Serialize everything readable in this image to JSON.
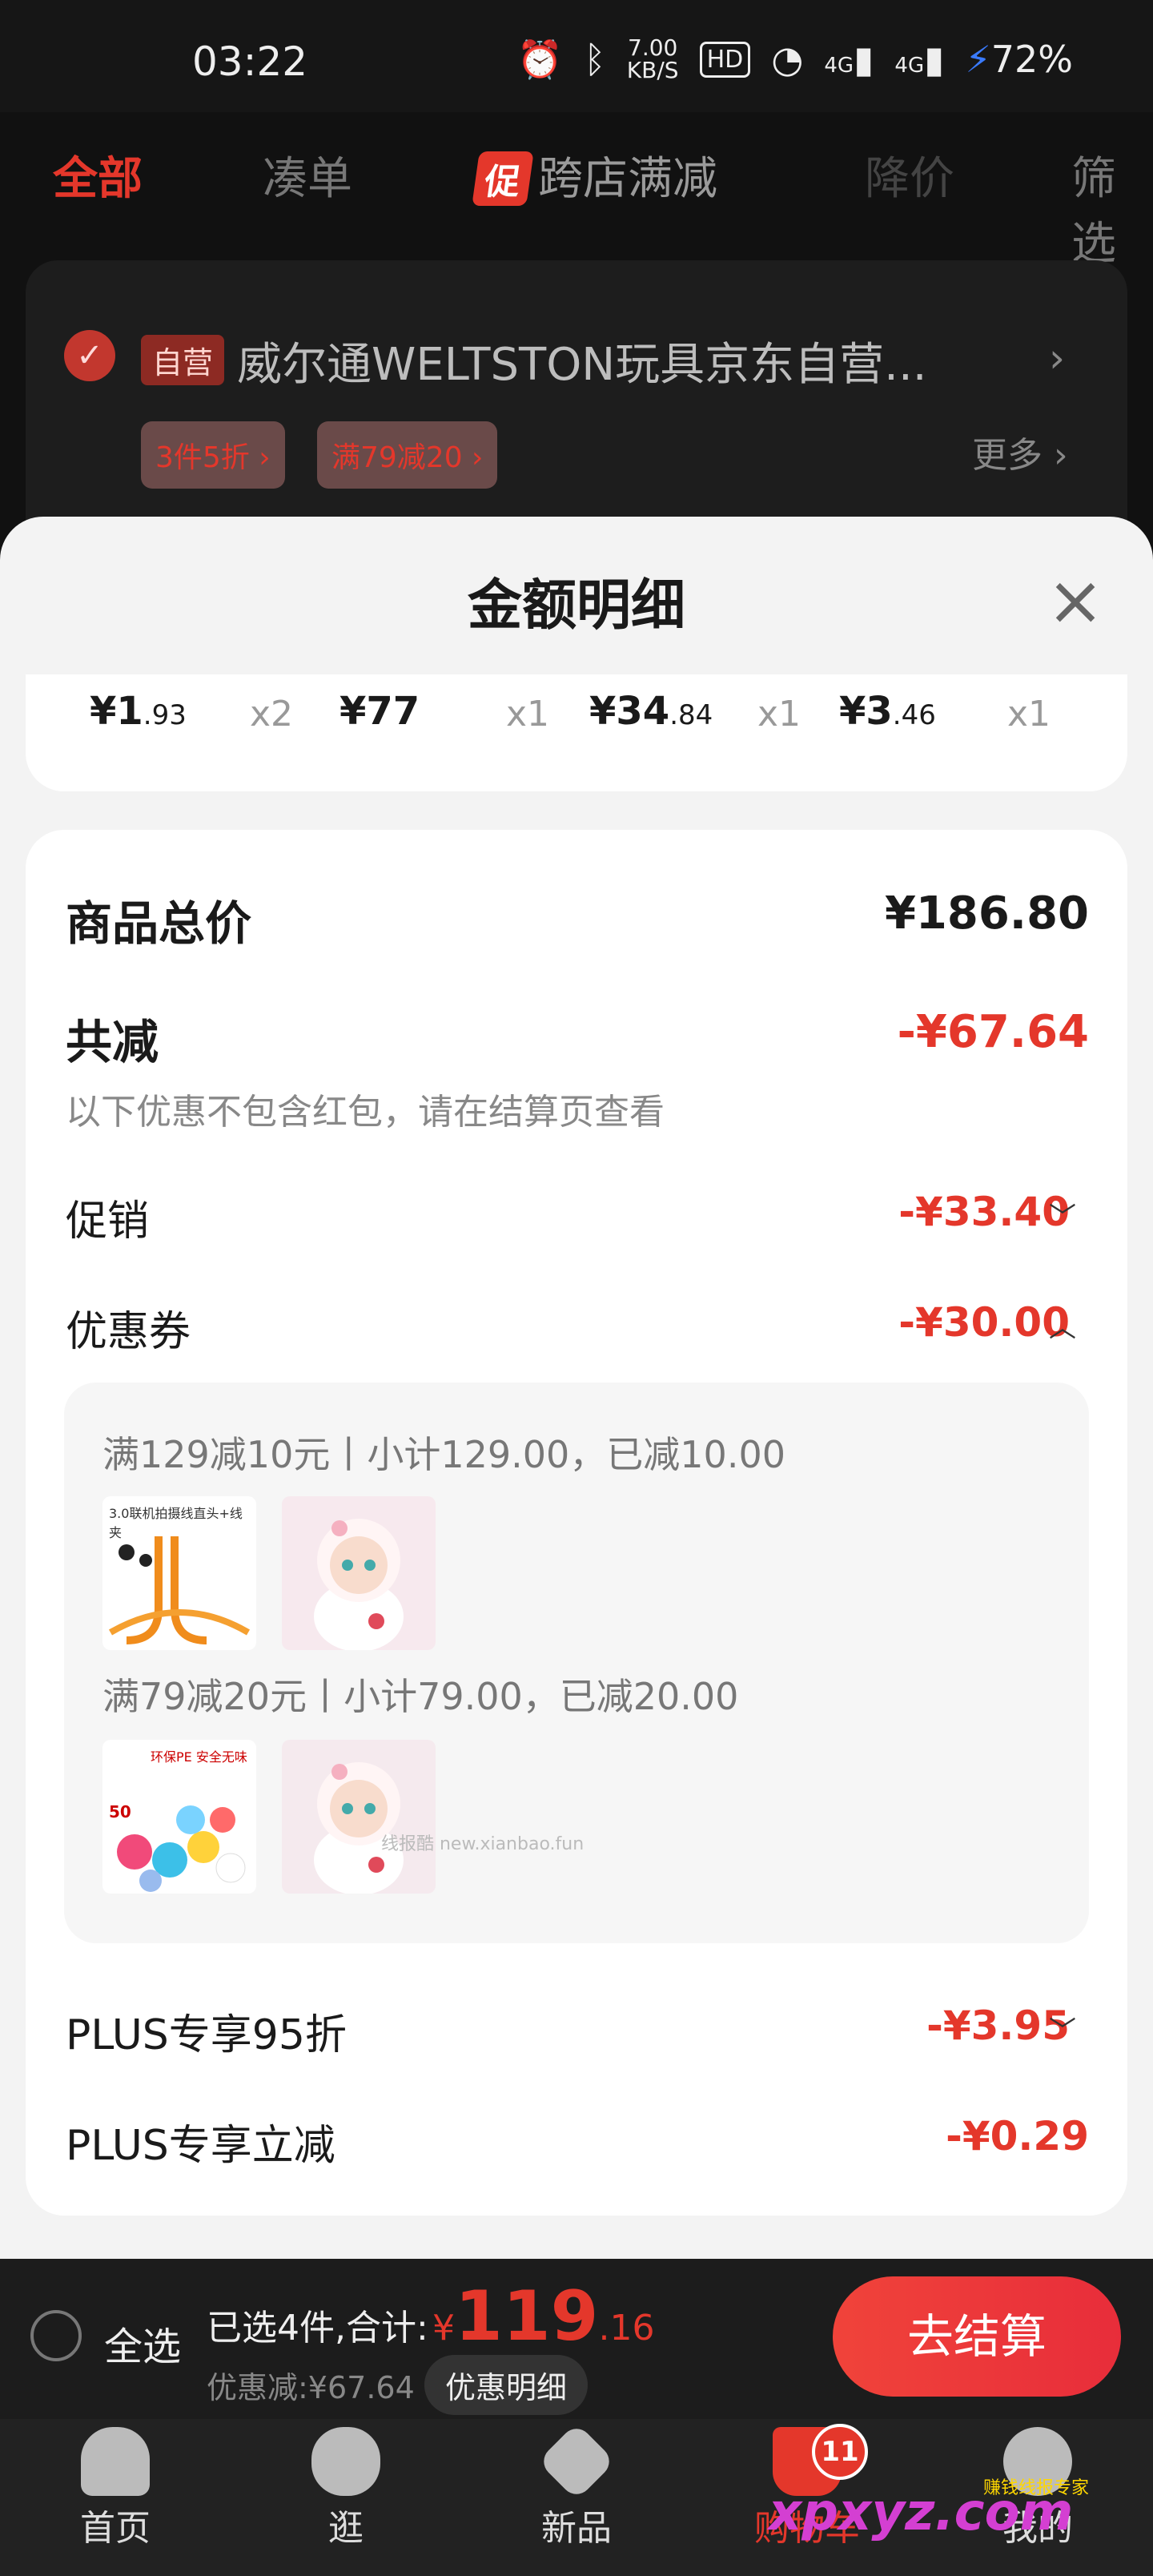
{
  "status_bar": {
    "time": "03:22",
    "net_speed": "7.00",
    "net_unit": "KB/S",
    "hd": "HD",
    "signal1": "4G",
    "signal2": "4G",
    "battery": "72%"
  },
  "tabs": [
    {
      "label": "全部"
    },
    {
      "label": "凑单"
    },
    {
      "label": "跨店满减",
      "tag": "促"
    },
    {
      "label": "降价"
    },
    {
      "label": "筛选"
    }
  ],
  "store": {
    "badge": "自营",
    "name": "威尔通WELTSTON玩具京东自营...",
    "chips": [
      "3件5折 ›",
      "满79减20 ›"
    ],
    "more": "更多 ›"
  },
  "modal": {
    "title": "金额明细",
    "items": [
      {
        "price_int": "¥1",
        "price_dec": ".93",
        "qty": "x2"
      },
      {
        "price_int": "¥77",
        "price_dec": "",
        "qty": "x1"
      },
      {
        "price_int": "¥34",
        "price_dec": ".84",
        "qty": "x1"
      },
      {
        "price_int": "¥3",
        "price_dec": ".46",
        "qty": "x1"
      }
    ],
    "total_label": "商品总价",
    "total_value": "¥186.80",
    "reduce_label": "共减",
    "reduce_value": "-¥67.64",
    "reduce_note": "以下优惠不包含红包，请在结算页查看",
    "promo_label": "促销",
    "promo_value": "-¥33.40",
    "coupon_label": "优惠券",
    "coupon_value": "-¥30.00",
    "coupons": [
      {
        "line": "满129减10元丨小计129.00，已减10.00",
        "thumb_text": "3.0联机拍摄线直头+线夹"
      },
      {
        "line": "满79减20元丨小计79.00，已减20.00",
        "thumb_text": "环保PE 安全无味",
        "thumb_num": "50"
      }
    ],
    "plus95_label": "PLUS专享95折",
    "plus95_value": "-¥3.95",
    "plusdirect_label": "PLUS专享立减",
    "plusdirect_value": "-¥0.29"
  },
  "checkout": {
    "select_all": "全选",
    "selected": "已选4件,合计:",
    "currency": "¥",
    "amount_int": "119",
    "amount_dec": ".16",
    "discount": "优惠减:¥67.64",
    "detail_btn": "优惠明细",
    "checkout_btn": "去结算"
  },
  "nav": [
    {
      "label": "首页"
    },
    {
      "label": "逛"
    },
    {
      "label": "新品"
    },
    {
      "label": "购物车",
      "badge": "11"
    },
    {
      "label": "我的"
    }
  ],
  "watermark": "xpxyz.com",
  "watermark_tag": "赚钱线报专家",
  "watermark_small": "线报酷 new.xianbao.fun",
  "colors": {
    "accent": "#e4372b",
    "modal_bg": "#f3f3f3"
  }
}
